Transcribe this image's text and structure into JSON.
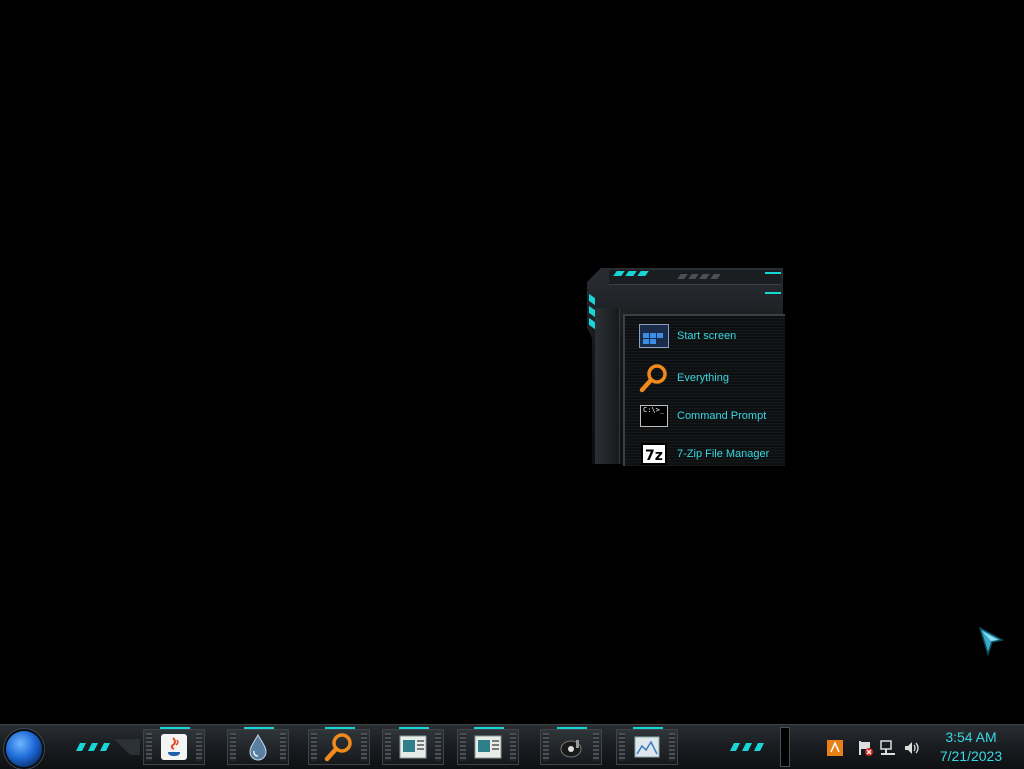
{
  "desktop": {
    "start_menu": {
      "items": [
        {
          "label": "Start screen",
          "icon": "start-screen-icon"
        },
        {
          "label": "Everything",
          "icon": "magnifier-icon"
        },
        {
          "label": "Command Prompt",
          "icon": "command-prompt-icon",
          "icon_text": "C:\\>_"
        },
        {
          "label": "7-Zip File Manager",
          "icon": "7zip-icon",
          "icon_text": "7z"
        }
      ]
    }
  },
  "taskbar": {
    "start_button": "start-orb-icon",
    "pinned": [
      {
        "name": "java-icon"
      },
      {
        "name": "water-drop-icon"
      },
      {
        "name": "everything-search-icon"
      },
      {
        "name": "document-window-icon"
      },
      {
        "name": "document-window-icon-2"
      },
      {
        "name": "media-player-icon"
      },
      {
        "name": "image-viewer-icon"
      }
    ],
    "tray": [
      {
        "name": "update-icon"
      },
      {
        "name": "action-center-flag-icon"
      },
      {
        "name": "network-icon"
      },
      {
        "name": "volume-icon"
      }
    ],
    "clock": {
      "time": "3:54 AM",
      "date": "7/21/2023"
    }
  },
  "colors": {
    "accent": "#19d6d6",
    "text_cyan": "#38d8e0",
    "background": "#000000"
  }
}
